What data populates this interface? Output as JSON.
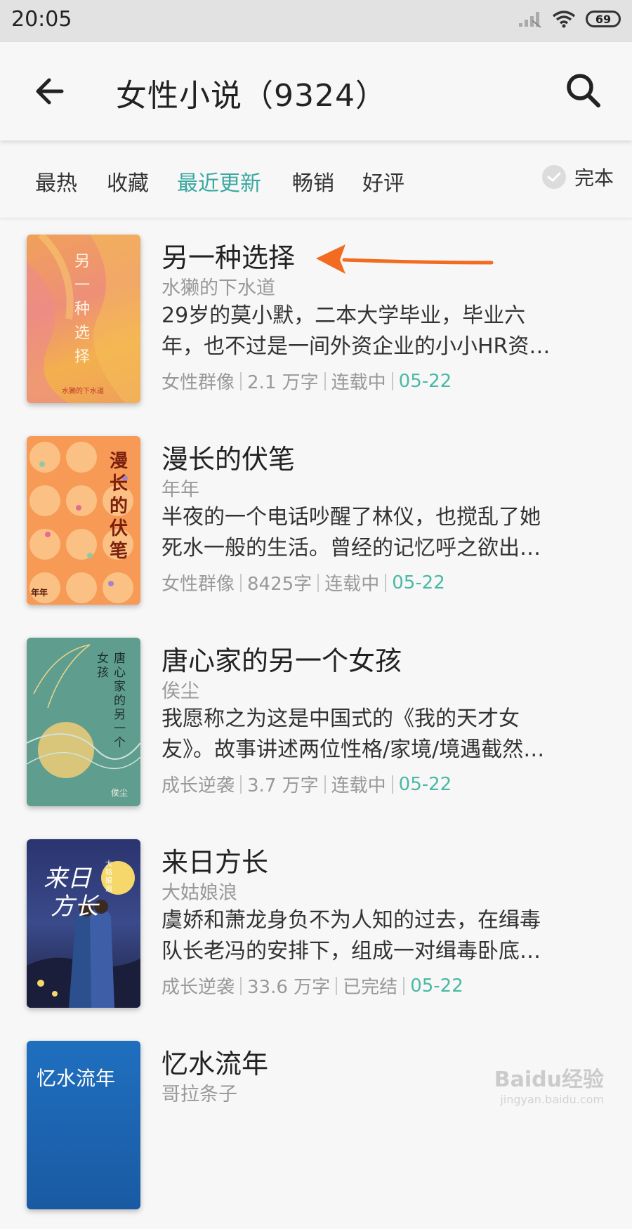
{
  "status_bar": {
    "time": "20:05",
    "battery": "69"
  },
  "header": {
    "title": "女性小说（9324）"
  },
  "filters": {
    "tabs": [
      "最热",
      "收藏",
      "最近更新",
      "畅销",
      "好评"
    ],
    "active": "最近更新",
    "finished_label": "完本"
  },
  "books": [
    {
      "title": "另一种选择",
      "author": "水獭的下水道",
      "desc_line1": "29岁的莫小默，二本大学毕业，毕业六",
      "desc_line2": "年，也不过是一间外资企业的小小HR资…",
      "category": "女性群像",
      "words": "2.1 万字",
      "status": "连载中",
      "date": "05-22",
      "cover_title": "另一种选择",
      "cover_author": "水獭的下水道"
    },
    {
      "title": "漫长的伏笔",
      "author": "年年",
      "desc_line1": "半夜的一个电话吵醒了林仪，也搅乱了她",
      "desc_line2": "死水一般的生活。曾经的记忆呼之欲出…",
      "category": "女性群像",
      "words": "8425字",
      "status": "连载中",
      "date": "05-22",
      "cover_title": "漫长的伏笔",
      "cover_author": "年年"
    },
    {
      "title": "唐心家的另一个女孩",
      "author": "俟尘",
      "desc_line1": "我愿称之为这是中国式的《我的天才女",
      "desc_line2": "友》。故事讲述两位性格/家境/境遇截然…",
      "category": "成长逆袭",
      "words": "3.7 万字",
      "status": "连载中",
      "date": "05-22",
      "cover_title_a": "唐心家的另一个",
      "cover_title_b": "女孩",
      "cover_author": "俟尘"
    },
    {
      "title": "来日方长",
      "author": "大姑娘浪",
      "desc_line1": "虞娇和萧龙身负不为人知的过去，在缉毒",
      "desc_line2": "队长老冯的安排下，组成一对缉毒卧底…",
      "category": "成长逆袭",
      "words": "33.6 万字",
      "status": "已完结",
      "date": "05-22",
      "cover_title_a": "来日",
      "cover_title_b": "方长",
      "cover_author": "大姑娘浪"
    },
    {
      "title": "忆水流年",
      "author": "哥拉条子",
      "cover_title": "忆水流年"
    }
  ],
  "colors": {
    "accent": "#3aa7a0",
    "date": "#4ab8a6",
    "annotation_arrow": "#f26b21"
  },
  "watermark": {
    "text": "Baidu经验",
    "url": "jingyan.baidu.com"
  }
}
